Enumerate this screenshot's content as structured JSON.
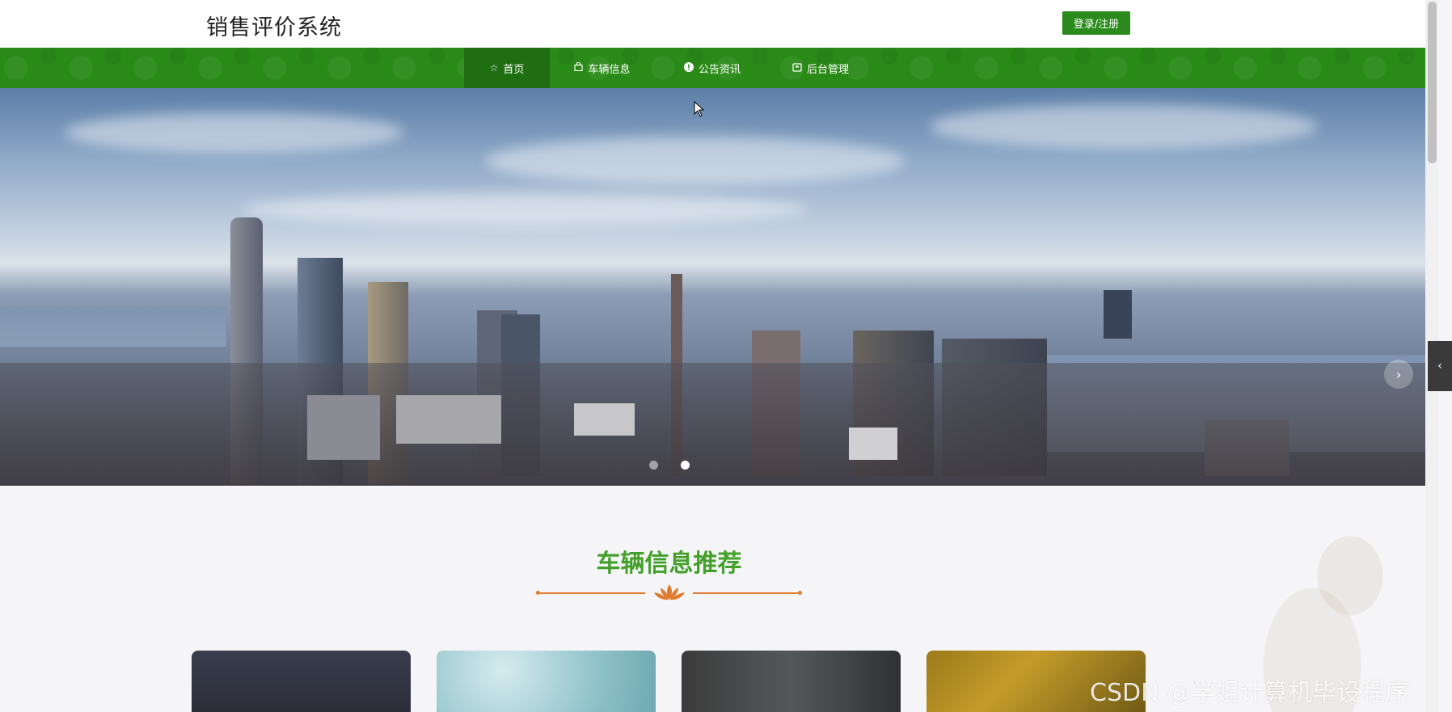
{
  "header": {
    "site_title": "销售评价系统",
    "login_label": "登录/注册"
  },
  "nav": {
    "items": [
      {
        "label": "首页",
        "icon": "star-icon",
        "active": true
      },
      {
        "label": "车辆信息",
        "icon": "bag-icon",
        "active": false
      },
      {
        "label": "公告资讯",
        "icon": "info-circle-icon",
        "active": false
      },
      {
        "label": "后台管理",
        "icon": "box-icon",
        "active": false
      }
    ]
  },
  "hero": {
    "slide_count": 2,
    "active_slide": 2,
    "next_icon": "chevron-right-icon"
  },
  "section": {
    "title": "车辆信息推荐",
    "ornament_icon": "lotus-icon"
  },
  "cards": [
    {
      "name": "card-1"
    },
    {
      "name": "card-2"
    },
    {
      "name": "card-3"
    },
    {
      "name": "card-4"
    }
  ],
  "side_tab_icon": "chevron-left-icon",
  "watermark": "CSDN @学姐计算机毕设程序",
  "colors": {
    "brand_green": "#2a8a17",
    "title_green": "#43a02a",
    "accent_orange": "#e07a2e"
  }
}
